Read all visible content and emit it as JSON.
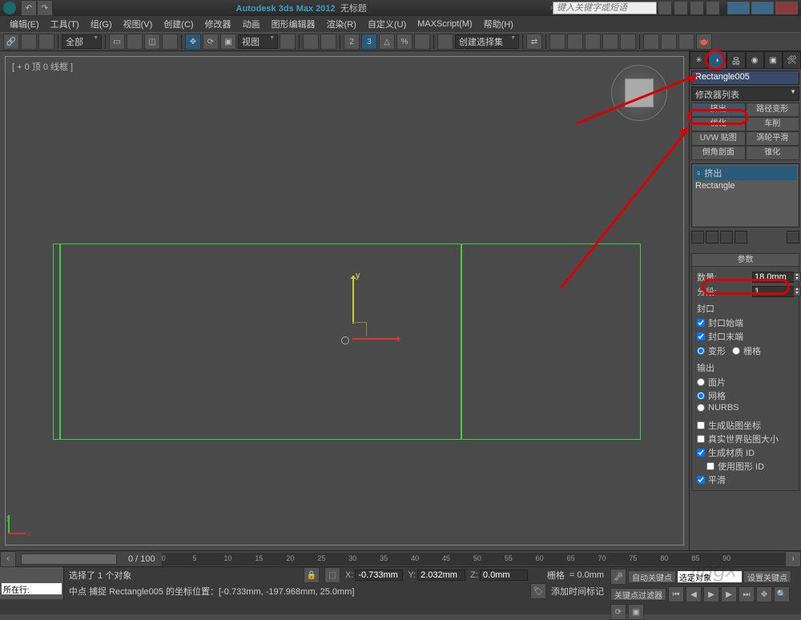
{
  "title": {
    "app": "Autodesk 3ds Max  2012",
    "doc": "无标题"
  },
  "search_placeholder": "键入关键字或短语",
  "menu": [
    "编辑(E)",
    "工具(T)",
    "组(G)",
    "视图(V)",
    "创建(C)",
    "修改器",
    "动画",
    "图形编辑器",
    "渲染(R)",
    "自定义(U)",
    "MAXScript(M)",
    "帮助(H)"
  ],
  "toolbar": {
    "scope": "全部",
    "viewbtn": "视图",
    "selset": "创建选择集"
  },
  "viewport": {
    "label": "[ + 0 顶 0 线框 ]",
    "axis_x": "x",
    "axis_y": "y"
  },
  "cmd": {
    "object_name": "Rectangle005",
    "modifier_dd": "修改器列表",
    "btns": [
      [
        "挤出",
        "路径变形"
      ],
      [
        "优化",
        "车削"
      ],
      [
        "UVW 贴图",
        "涡轮平滑"
      ],
      [
        "倒角剖面",
        "锥化"
      ]
    ],
    "stack": {
      "sel": "♀  挤出",
      "item": "Rectangle"
    },
    "rollout_title": "参数",
    "amount_label": "数量:",
    "amount_value": "18.0mm",
    "segments_label": "分段:",
    "segments_value": "1",
    "cap_group": "封口",
    "cap_start": "封口始端",
    "cap_end": "封口末端",
    "cap_morph": "变形",
    "cap_grid": "栅格",
    "out_group": "输出",
    "out_patch": "面片",
    "out_mesh": "网格",
    "out_nurbs": "NURBS",
    "gen_map": "生成贴图坐标",
    "real_world": "真实世界贴图大小",
    "gen_mat": "生成材质 ID",
    "use_shape": "使用图形 ID",
    "smooth": "平滑"
  },
  "timeline": {
    "frame": "0 / 100",
    "ticks": [
      "0",
      "5",
      "10",
      "15",
      "20",
      "25",
      "30",
      "35",
      "40",
      "45",
      "50",
      "55",
      "60",
      "65",
      "70",
      "75",
      "80",
      "85",
      "90"
    ]
  },
  "status": {
    "sel_label": "所在行:",
    "line1": "选择了 1 个对象",
    "line2": "中点 捕捉 Rectangle005 的坐标位置：[-0.733mm, -197.968mm, 25.0mm]",
    "x_lbl": "X:",
    "x": "-0.733mm",
    "y_lbl": "Y:",
    "y": "2.032mm",
    "z_lbl": "Z:",
    "z": "0.0mm",
    "grid_lbl": "栅格",
    "grid": "= 0.0mm",
    "autokey": "自动关键点",
    "setkey": "设置关键点",
    "seldd": "选定对象",
    "keyfilter": "关键点过滤器",
    "addmarker": "添加时间标记"
  }
}
